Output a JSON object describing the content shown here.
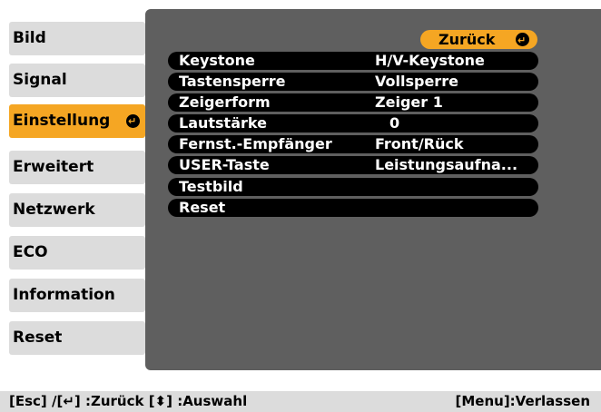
{
  "sidebar": {
    "items": [
      {
        "label": "Bild"
      },
      {
        "label": "Signal"
      },
      {
        "label": "Einstellung"
      },
      {
        "label": "Erweitert"
      },
      {
        "label": "Netzwerk"
      },
      {
        "label": "ECO"
      },
      {
        "label": "Information"
      },
      {
        "label": "Reset"
      }
    ],
    "active_index": 2
  },
  "back_button": {
    "label": "Zurück"
  },
  "menu": {
    "rows": [
      {
        "label": "Keystone",
        "value": "H/V-Keystone"
      },
      {
        "label": "Tastensperre",
        "value": "Vollsperre"
      },
      {
        "label": "Zeigerform",
        "value": "Zeiger 1"
      },
      {
        "label": "Lautstärke",
        "value": "0"
      },
      {
        "label": "Fernst.-Empfänger",
        "value": "Front/Rück"
      },
      {
        "label": "USER-Taste",
        "value": "Leistungsaufna..."
      },
      {
        "label": "Testbild",
        "value": ""
      },
      {
        "label": "Reset",
        "value": ""
      }
    ]
  },
  "footer": {
    "left": "[Esc] /[↵] :Zurück  [⬍] :Auswahl",
    "right": "[Menu]:Verlassen"
  },
  "colors": {
    "accent": "#f5a623",
    "panel": "#5f5f5f",
    "tab": "#dcdcdc",
    "row": "#000000"
  }
}
